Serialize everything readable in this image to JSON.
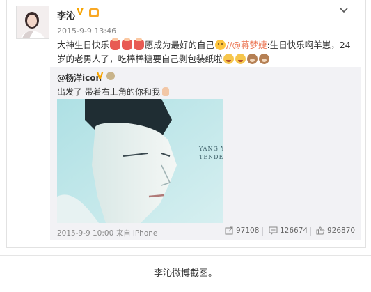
{
  "post": {
    "author": "李沁",
    "verified_mark": "V",
    "time": "2015-9-9 13:46",
    "text_part1": "大神生日快乐",
    "text_part2": "愿成为最好的自己",
    "repost_sep": "//",
    "mention": "@蒋梦婕",
    "text_part3": ":生日快乐啊羊崽，24岁的老男人了，吃棒棒糖要自己剥包装纸啦"
  },
  "repost": {
    "author": "@杨洋icon",
    "verified_mark": "V",
    "text": "出发了 带着右上角的你和我",
    "photo_caption_line1": "YANG Y",
    "photo_caption_line2": "TENDER I",
    "time_source": "2015-9-9 10:00 来自 iPhone",
    "reposts": "97108",
    "comments": "126674",
    "likes": "926870"
  },
  "caption": "李沁微博截图。",
  "colors": {
    "mention": "#eb7350",
    "verified": "#f7a400",
    "repost_bg": "#f2f2f5",
    "photo_bg": "#bfe6e9"
  },
  "icons": [
    "chevron-down-icon",
    "repost-icon",
    "comment-icon",
    "like-icon"
  ]
}
